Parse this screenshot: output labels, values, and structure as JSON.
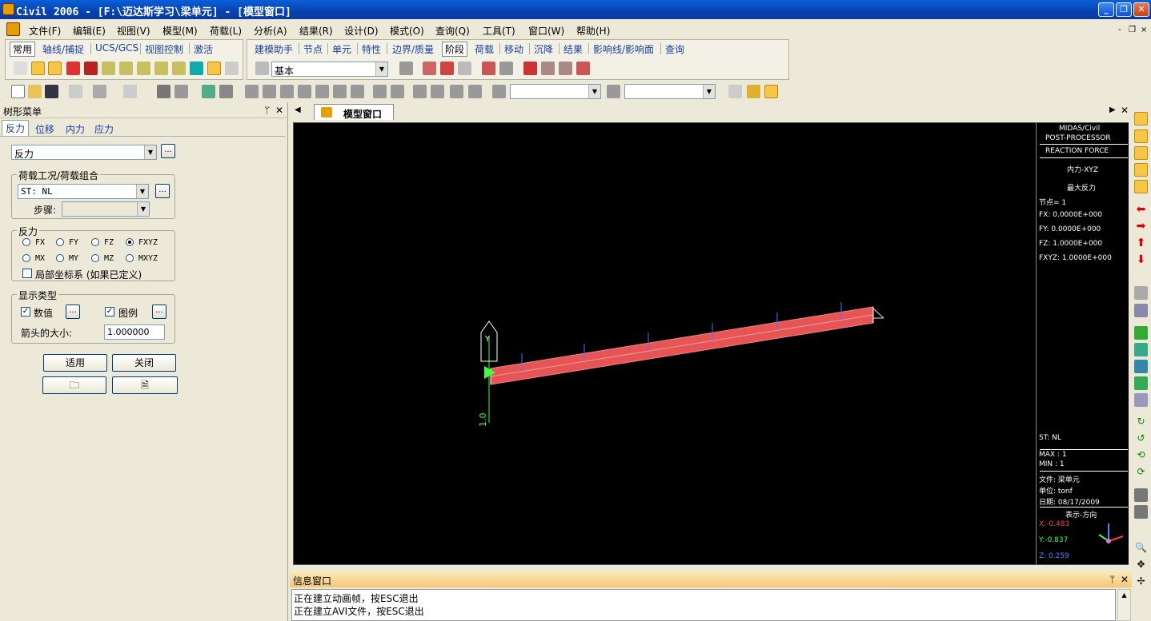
{
  "window": {
    "title": "Civil 2006 - [F:\\迈达斯学习\\梁单元] - [模型窗口]",
    "min": "_",
    "max": "❐",
    "close": "✕"
  },
  "menu": [
    "文件(F)",
    "编辑(E)",
    "视图(V)",
    "模型(M)",
    "荷载(L)",
    "分析(A)",
    "结果(R)",
    "设计(D)",
    "模式(O)",
    "查询(Q)",
    "工具(T)",
    "窗口(W)",
    "帮助(H)"
  ],
  "mdi": {
    "min": "-",
    "restore": "❐",
    "close": "×"
  },
  "toolbar_tabs_left": [
    "常用",
    "轴线/捕捉",
    "UCS/GCS",
    "视图控制",
    "激活"
  ],
  "toolbar_tabs_right": [
    "建模助手",
    "节点",
    "单元",
    "特性",
    "边界/质量",
    "阶段",
    "荷载",
    "移动",
    "沉降",
    "结果",
    "影响线/影响面",
    "查询"
  ],
  "stage_combo": "基本",
  "tree": {
    "title": "树形菜单",
    "pin": "ᛘ",
    "close": "✕",
    "tabs": [
      "反力",
      "位移",
      "内力",
      "应力"
    ],
    "type_select": "反力",
    "lc_group": "荷载工况/荷载组合",
    "lc_value": "ST: NL",
    "step_label": "步骤:",
    "force_group": "反力",
    "radios": [
      "FX",
      "FY",
      "FZ",
      "FXYZ",
      "MX",
      "MY",
      "MZ",
      "MXYZ"
    ],
    "local_cs": "局部坐标系 (如果已定义)",
    "display_group": "显示类型",
    "chk_value": "数值",
    "chk_legend": "图例",
    "arrow_size_label": "箭头的大小:",
    "arrow_size": "1.000000",
    "apply": "适用",
    "close_btn": "关闭"
  },
  "doc_tab": "模型窗口",
  "legend": {
    "l1": "MIDAS/Civil",
    "l2": "POST-PROCESSOR",
    "l3": "REACTION FORCE",
    "l4": "内力-XYZ",
    "l5": "最大反力",
    "node": "节点= 1",
    "fx": "FX:    0.0000E+000",
    "fy": "FY:    0.0000E+000",
    "fz": "FZ:    1.0000E+000",
    "fxyz": "FXYZ: 1.0000E+000",
    "st": "ST: NL",
    "max": "MAX : 1",
    "min": "MIN : 1",
    "file": "文件:  梁单元",
    "unit": "单位:  tonf",
    "date": "日期:  08/17/2009",
    "dir": "表示-方向",
    "x": "X:-0.483",
    "y": "Y:-0.837",
    "z": "Z:  0.259",
    "colors": {
      "x": "#ff4040",
      "y": "#40ff40",
      "z": "#6080ff"
    }
  },
  "viewport": {
    "reaction_value": "1.0",
    "support_label": "Y"
  },
  "info": {
    "title": "信息窗口",
    "lines": [
      "正在建立动画帧，按ESC退出",
      "正在建立AVI文件，按ESC退出"
    ]
  }
}
